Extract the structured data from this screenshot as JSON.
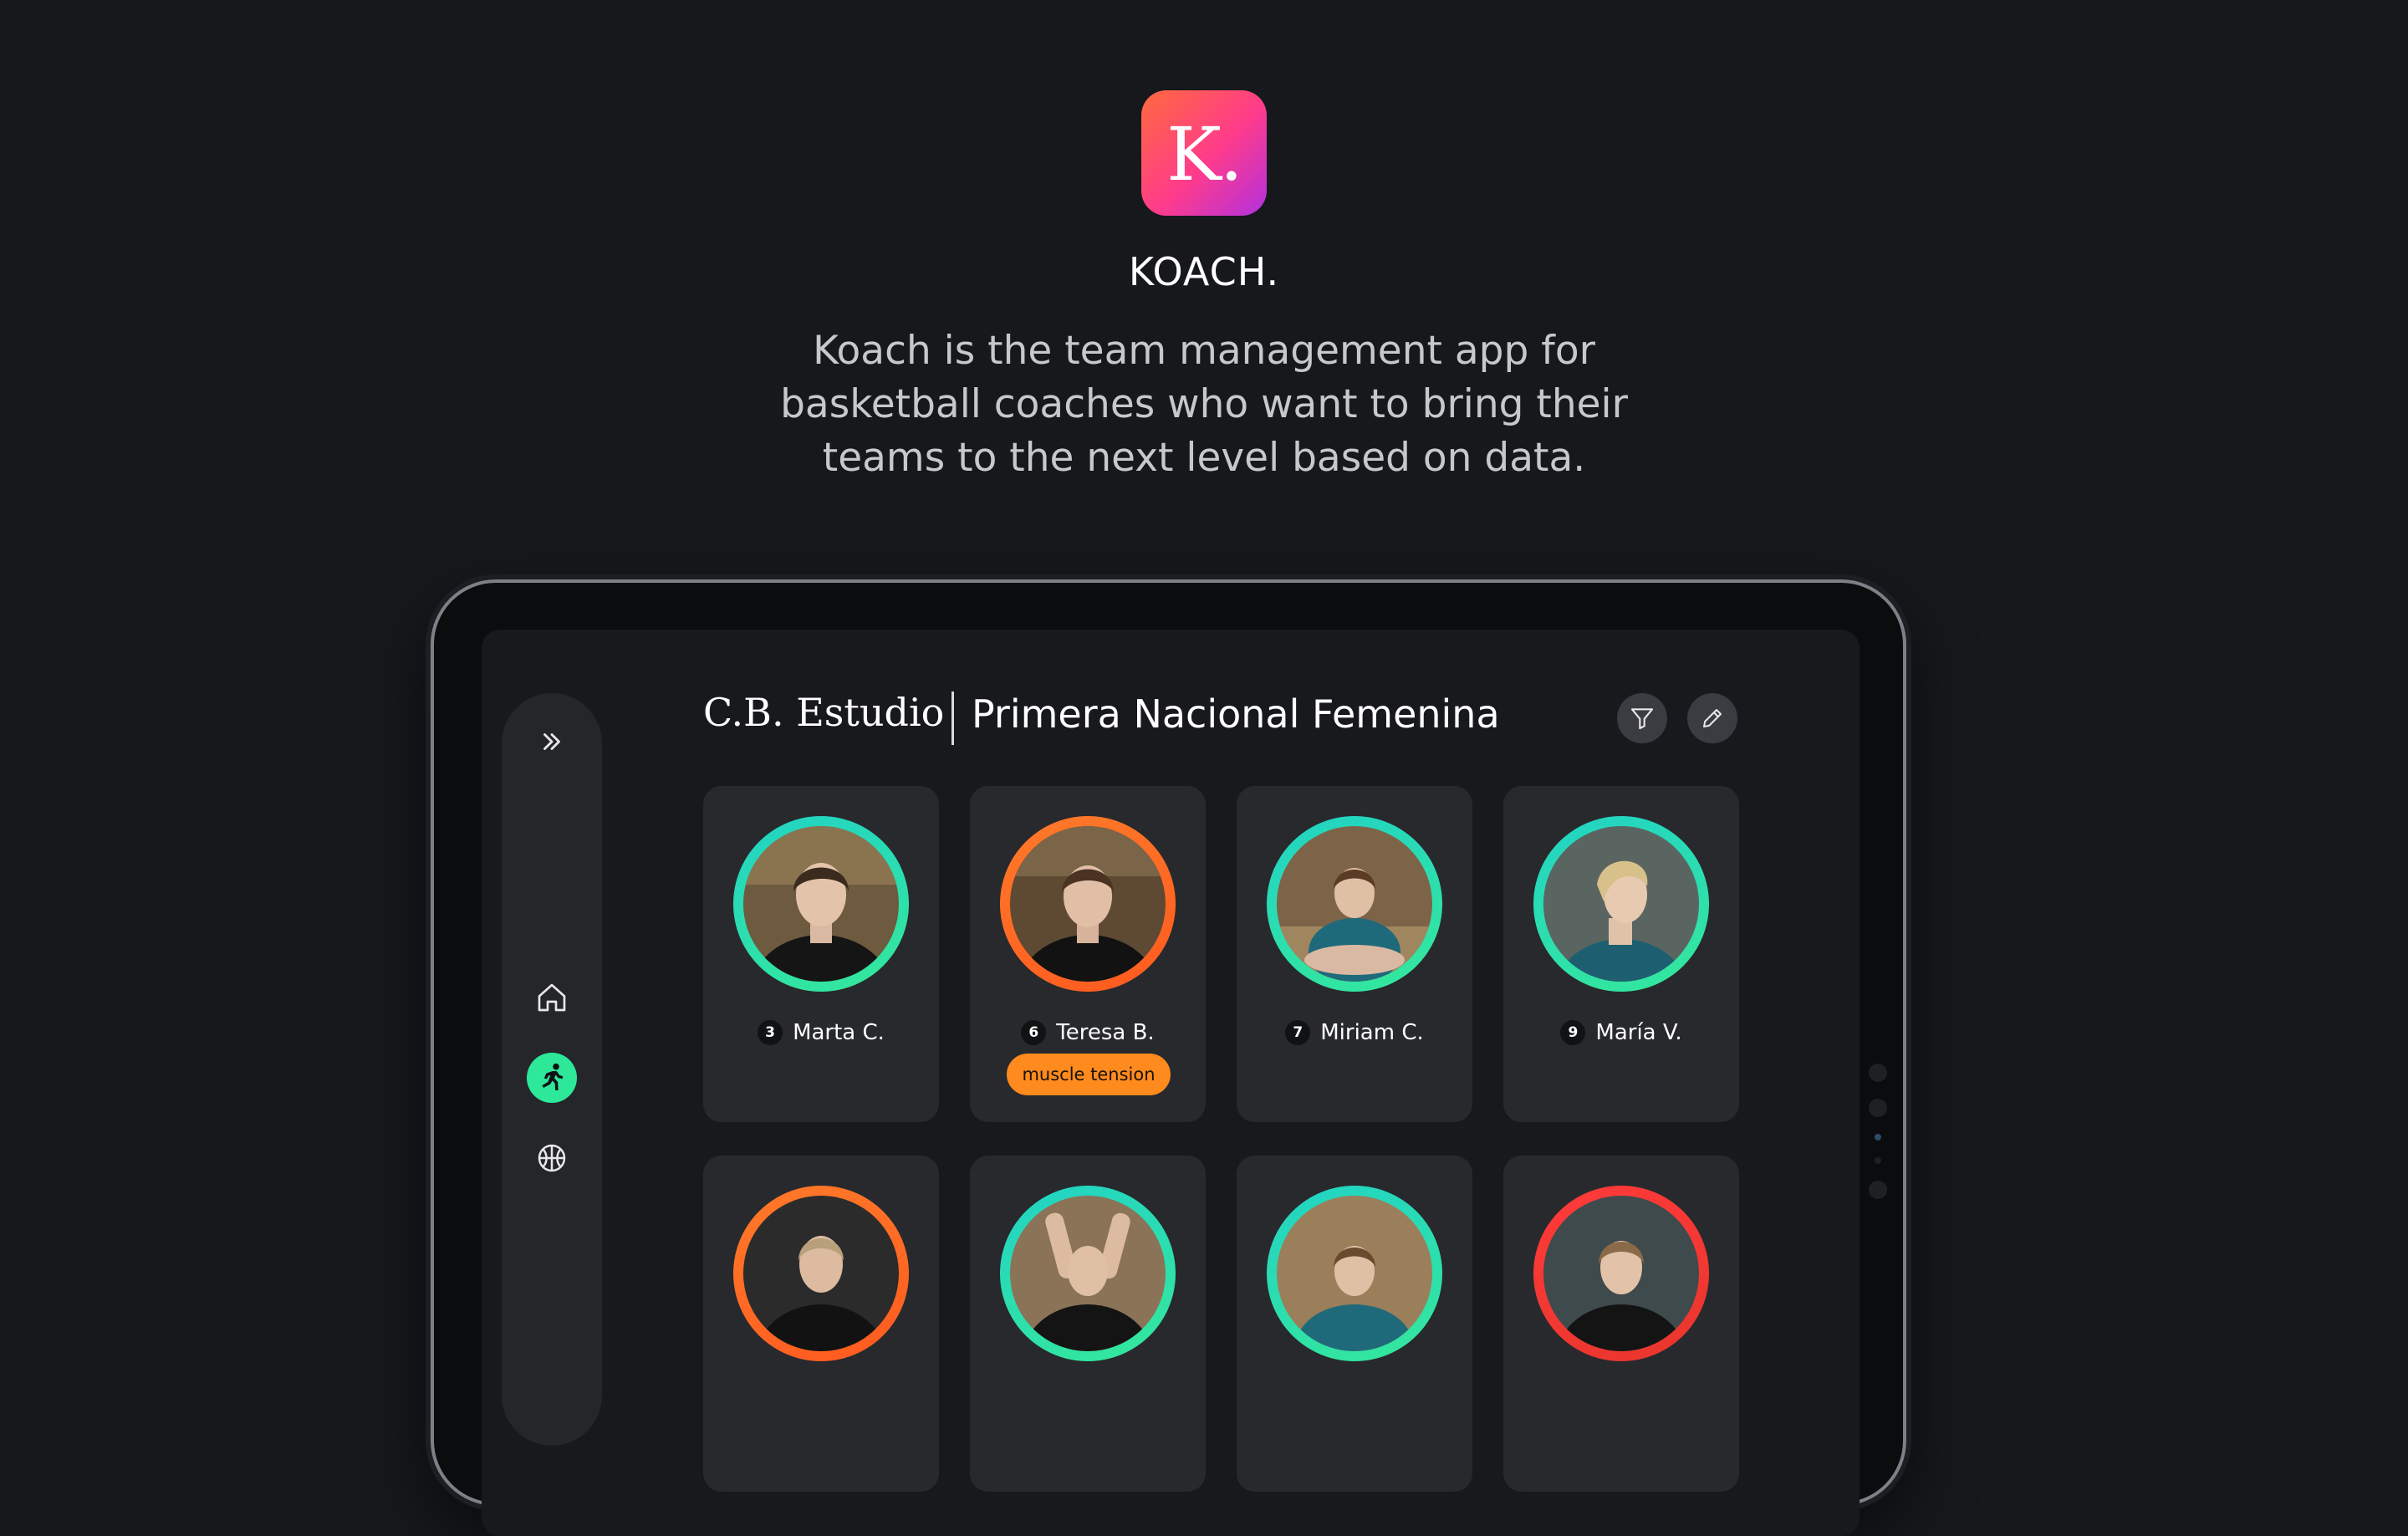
{
  "brand": {
    "logo_letter": "K.",
    "name": "KOACH.",
    "tagline_lines": [
      "Koach is the team management app for",
      "basketball coaches who want to bring their",
      "teams to the next level based on data."
    ],
    "gradient": [
      "#ff6a3d",
      "#ff3b8c",
      "#b131e0"
    ]
  },
  "sidebar": {
    "items": [
      {
        "icon": "chevrons-right-icon"
      },
      {
        "icon": "home-icon"
      },
      {
        "icon": "running-player-icon",
        "active": true,
        "accent": "#2ee89a"
      },
      {
        "icon": "basketball-icon"
      }
    ]
  },
  "header": {
    "club": "C.B. Estudio",
    "league": "Primera Nacional Femenina",
    "actions": [
      {
        "icon": "filter-icon"
      },
      {
        "icon": "edit-pencil-icon"
      }
    ]
  },
  "players": [
    {
      "number": "3",
      "name": "Marta C.",
      "status": "green",
      "tag": ""
    },
    {
      "number": "6",
      "name": "Teresa B.",
      "status": "orange",
      "tag": "muscle tension"
    },
    {
      "number": "7",
      "name": "Miriam C.",
      "status": "green",
      "tag": ""
    },
    {
      "number": "9",
      "name": "María V.",
      "status": "green",
      "tag": ""
    },
    {
      "number": "",
      "name": "",
      "status": "orange",
      "tag": ""
    },
    {
      "number": "",
      "name": "",
      "status": "green",
      "tag": ""
    },
    {
      "number": "",
      "name": "",
      "status": "green",
      "tag": ""
    },
    {
      "number": "",
      "name": "",
      "status": "red",
      "tag": ""
    }
  ],
  "status_colors": {
    "green": "#2ee89a",
    "orange": "#ff7a29",
    "red": "#ff3a3a",
    "tag": "#ff8a1e"
  }
}
